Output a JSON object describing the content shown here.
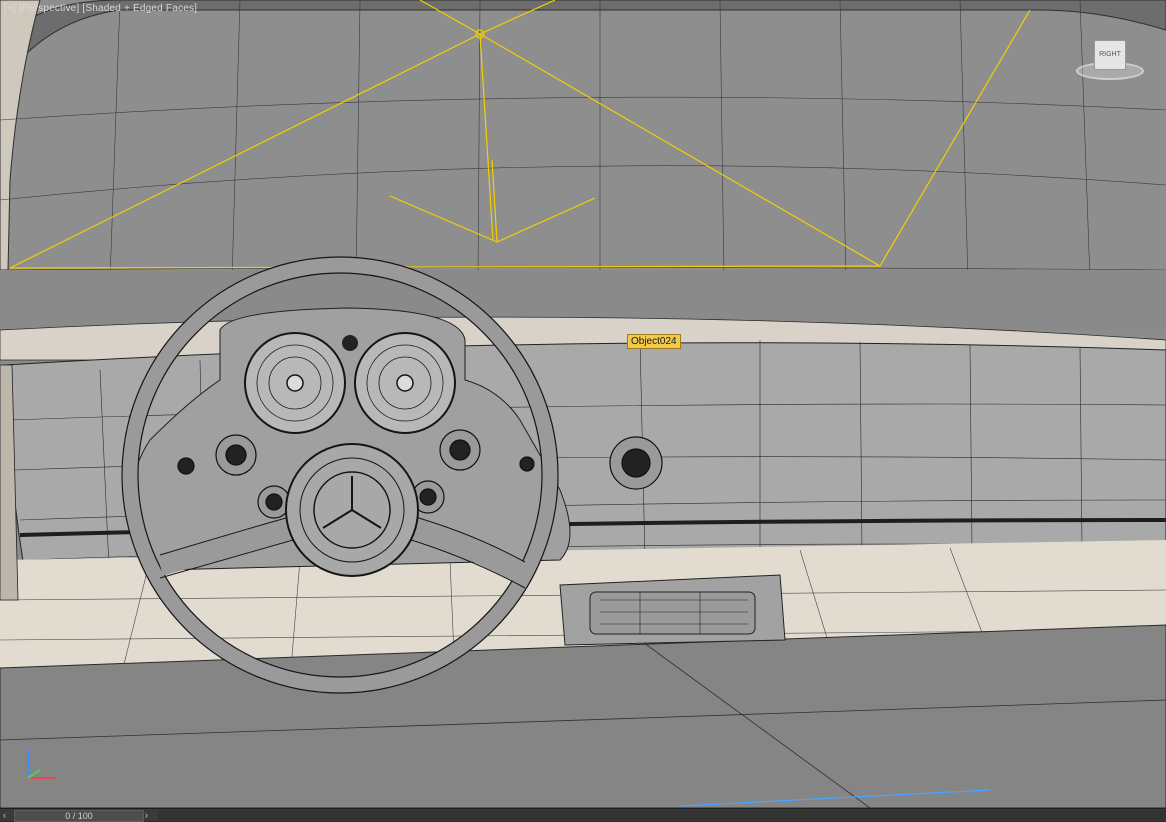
{
  "viewport": {
    "label_parts": [
      "[+]",
      "[Perspective]",
      "[Shaded + Edged Faces]"
    ],
    "selected_object_label": "Object024",
    "viewcube_face": "RIGHT",
    "background_color": "#8c8c8c"
  },
  "timeline": {
    "frame_display": "0 / 100",
    "prev_icon": "chevron-left-icon",
    "next_icon": "chevron-right-icon"
  },
  "colors": {
    "selection_yellow": "#f2d000",
    "tag_bg": "#f2c94c",
    "mesh_wire": "#2a2a2a"
  }
}
